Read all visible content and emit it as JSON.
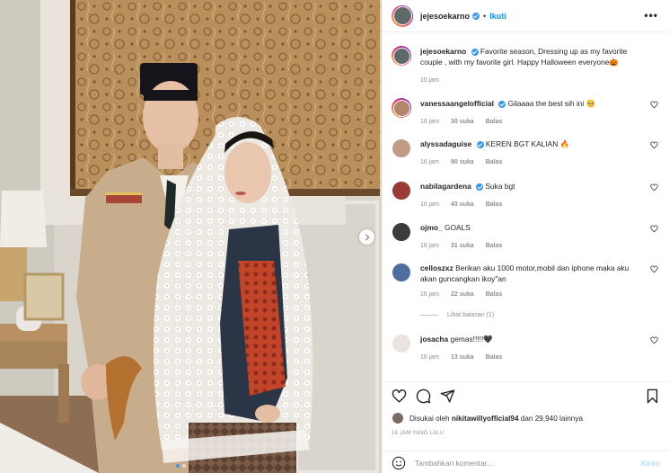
{
  "colors": {
    "accent": "#0095f6",
    "verified": "#3897f0",
    "muted": "#8e8e8e",
    "text": "#262626"
  },
  "header": {
    "username": "jejesoekarno",
    "separator": "•",
    "follow_label": "Ikuti",
    "more_icon": "more-dots-icon"
  },
  "caption": {
    "username": "jejesoekarno",
    "text": "Favorite season, Dressing up as my favorite couple , with my favorite girl. Happy Halloween everyone🎃",
    "time": "16 jam"
  },
  "comments": [
    {
      "username": "vanessaangelofficial",
      "verified": true,
      "text": "Gilaaaa the best sih ini 🥺",
      "time": "16 jam",
      "likes": "30 suka",
      "reply": "Balas"
    },
    {
      "username": "alyssadaguise",
      "verified": true,
      "text": "KEREN BGT KALIAN 🔥",
      "time": "16 jam",
      "likes": "90 suka",
      "reply": "Balas"
    },
    {
      "username": "nabilagardena",
      "verified": true,
      "text": "Suka bgt",
      "time": "16 jam",
      "likes": "43 suka",
      "reply": "Balas"
    },
    {
      "username": "ojmo_",
      "verified": false,
      "text": "GOALS",
      "time": "16 jam",
      "likes": "31 suka",
      "reply": "Balas"
    },
    {
      "username": "celloszxz",
      "verified": false,
      "text": "Berikan aku 1000 motor,mobil dan iphone maka aku akan guncangkan ikoy\"an",
      "time": "16 jam",
      "likes": "22 suka",
      "reply": "Balas"
    },
    {
      "username": "josacha",
      "verified": false,
      "text": "gemas!!!!!🖤",
      "time": "16 jam",
      "likes": "13 suka",
      "reply": "Balas"
    }
  ],
  "view_replies": "Lihat balasan (1)",
  "likes": {
    "prefix": "Disukai oleh",
    "username": "nikitawillyofficial94",
    "suffix": "dan 29,940 lainnya"
  },
  "timestamp": "16 JAM YANG LALU",
  "add_comment": {
    "placeholder": "Tambahkan komentar...",
    "post_label": "Kirim"
  }
}
